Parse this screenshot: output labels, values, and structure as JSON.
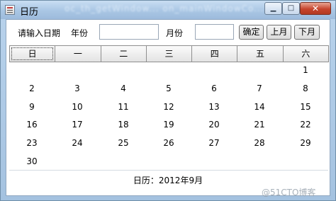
{
  "window": {
    "title": "日历",
    "blurred_title_text": "oc_th_getWindow... on_mainWindowCo..."
  },
  "controls": {
    "prompt_label": "请输入日期",
    "year_label": "年份",
    "year_value": "",
    "month_label": "月份",
    "month_value": "",
    "confirm_button": "确定",
    "prev_month_button": "上月",
    "next_month_button": "下月"
  },
  "weekdays": [
    "日",
    "一",
    "二",
    "三",
    "四",
    "五",
    "六"
  ],
  "calendar_rows": [
    [
      "",
      "",
      "",
      "",
      "",
      "",
      "1"
    ],
    [
      "2",
      "3",
      "4",
      "5",
      "6",
      "7",
      "8"
    ],
    [
      "9",
      "10",
      "11",
      "12",
      "13",
      "14",
      "15"
    ],
    [
      "16",
      "17",
      "18",
      "19",
      "20",
      "21",
      "22"
    ],
    [
      "23",
      "24",
      "25",
      "26",
      "27",
      "28",
      "29"
    ],
    [
      "30",
      "",
      "",
      "",
      "",
      "",
      ""
    ]
  ],
  "footer": {
    "label": "日历：2012年9月"
  },
  "watermark": "@51CTO博客"
}
